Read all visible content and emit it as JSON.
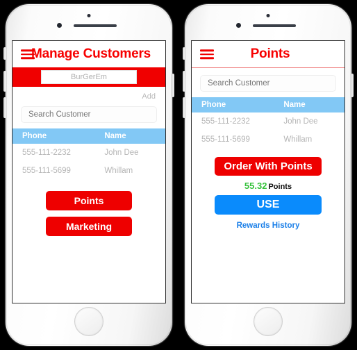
{
  "background_color": "#000000",
  "accent_red": "#f70000",
  "accent_blue": "#0a8bfc",
  "accent_green": "#35c23b",
  "table_header_blue": "#82c8f5",
  "phones": [
    {
      "name": "manage-customers-screen",
      "header": {
        "menu_icon": "hamburger-icon",
        "title": "Manage Customers"
      },
      "store_field": {
        "value": "BurGerEm",
        "placeholder": "BurGerEm"
      },
      "add_link": "Add",
      "search": {
        "value": "",
        "placeholder": "Search Customer"
      },
      "table": {
        "columns": [
          "Phone",
          "Name"
        ],
        "rows": [
          {
            "phone": "555-111-2232",
            "name": "John Dee"
          },
          {
            "phone": "555-111-5699",
            "name": "Whillam"
          }
        ]
      },
      "buttons": [
        {
          "label": "Points",
          "color": "#ee0000"
        },
        {
          "label": "Marketing",
          "color": "#ee0000"
        }
      ]
    },
    {
      "name": "points-screen",
      "header": {
        "menu_icon": "hamburger-icon",
        "title": "Points"
      },
      "search": {
        "value": "",
        "placeholder": "Search Customer"
      },
      "table": {
        "columns": [
          "Phone",
          "Name"
        ],
        "rows": [
          {
            "phone": "555-111-2232",
            "name": "John Dee"
          },
          {
            "phone": "555-111-5699",
            "name": "Whillam"
          }
        ]
      },
      "order_button": "Order With Points",
      "points": {
        "value": "55.32",
        "label": "Points"
      },
      "use_button": "USE",
      "rewards_link": "Rewards History"
    }
  ]
}
